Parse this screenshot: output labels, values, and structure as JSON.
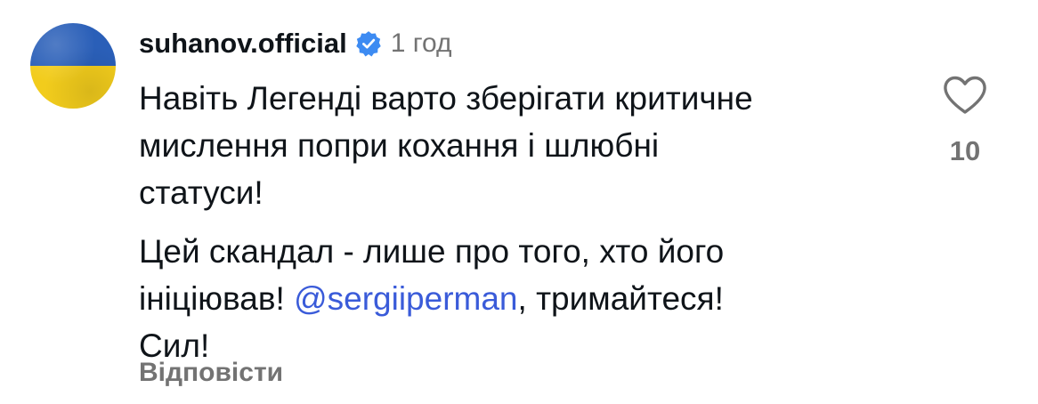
{
  "comment": {
    "username": "suhanov.official",
    "verified_icon": "verified-badge-icon",
    "timestamp": "1 год",
    "paragraph1": "Навіть Легенді варто зберігати критичне мислення попри кохання і шлюбні статуси!",
    "paragraph1_lines": [
      "Навіть Легенді варто зберігати критичне",
      "мислення попри кохання і шлюбні",
      "статуси!"
    ],
    "paragraph2_line1": "Цей скандал - лише про того, хто його",
    "paragraph2_line2_before": "ініціював! ",
    "mention": "@sergiiperman",
    "paragraph2_line2_after": ", тримайтеся!",
    "paragraph2_line3": "Сил!",
    "reply_label": "Відповісти",
    "like_icon": "heart-outline-icon",
    "like_count": "10"
  },
  "colors": {
    "text": "#0f1419",
    "secondary": "#737373",
    "mention": "#3a5bd9",
    "verified": "#3d8bf2",
    "flag_blue": "#2a5fb8",
    "flag_yellow": "#f2cc1c"
  }
}
